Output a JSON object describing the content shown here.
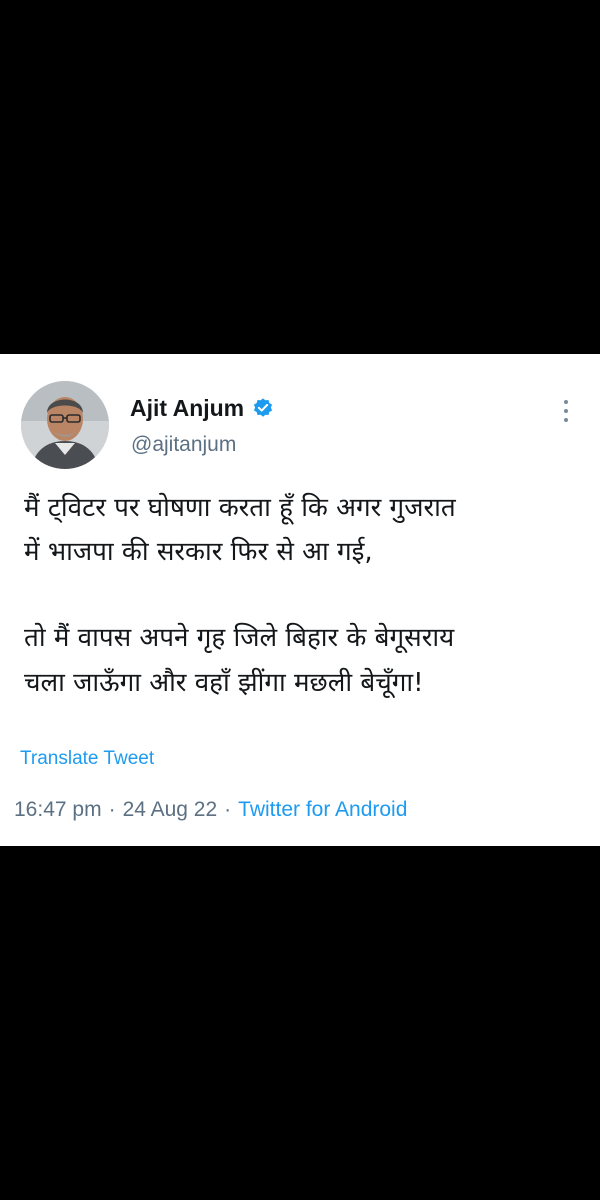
{
  "tweet": {
    "author_name": "Ajit Anjum",
    "author_handle": "@ajitanjum",
    "verified_icon": "verified-badge-icon",
    "more_icon": "more-vertical-icon",
    "body_lines": [
      "मैं ट्विटर पर घोषणा करता हूँ कि अगर गुजरात",
      "में भाजपा की सरकार फिर से आ गई,",
      "तो मैं वापस अपने गृह जिले बिहार के बेगूसराय",
      "चला जाऊँगा और वहाँ झींगा मछली बेचूँगा!"
    ],
    "translate_label": "Translate Tweet",
    "time": "16:47 pm",
    "date": "24 Aug 22",
    "separator": "·",
    "source": "Twitter for Android"
  },
  "colors": {
    "background": "#000000",
    "card": "#ffffff",
    "text_primary": "#14171a",
    "text_secondary": "#5b7083",
    "accent": "#1d9bf0"
  }
}
